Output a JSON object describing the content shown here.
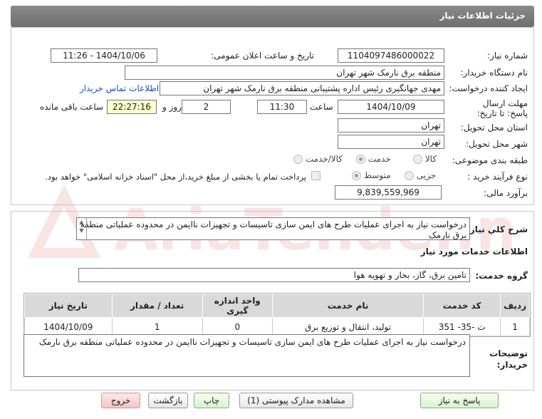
{
  "window": {
    "title": "جزئیات اطلاعات نیاز"
  },
  "form": {
    "need_number_label": "شماره نیاز:",
    "need_number": "1104097486000022",
    "announce_label": "تاریخ و ساعت اعلان عمومی:",
    "announce_value": "1404/10/06 - 11:26",
    "buyer_org_label": "نام دستگاه خریدار:",
    "buyer_org": "منطقه برق نارمک شهر تهران",
    "creator_label": "ایجاد کننده درخواست:",
    "creator": "مهدی جهانگیری رئیس اداره پشتیبانی  منطقه برق نارمک شهر تهران",
    "contact_link": "اطلاعات تماس خریدار",
    "deadline_label": "مهلت ارسال پاسخ: تا تاریخ:",
    "deadline_date": "1404/10/09",
    "time_label": "ساعت",
    "deadline_time": "11:30",
    "days_value": "2",
    "days_label": "روز و",
    "remaining_value": "22:27:16",
    "remaining_label": "ساعت باقی مانده",
    "province_label": "استان محل تحویل:",
    "province": "تهران",
    "city_label": "شهر محل تحویل:",
    "city": "تهران",
    "category_label": "طبقه بندی موضوعی:",
    "category_options": [
      "کالا",
      "خدمت",
      "کالا/خدمت"
    ],
    "process_label": "نوع فرآیند خرید :",
    "process_options": [
      "جزیی",
      "متوسط"
    ],
    "payment_note": "پرداخت تمام یا بخشی از مبلغ خرید،از محل \"اسناد خزانه اسلامی\" خواهد بود.",
    "budget_label": "برآورد مالی:",
    "budget": "9,839,559,969"
  },
  "summary": {
    "label": "شرح کلي نياز:",
    "text": "درخواست نیاز به اجرای عملیات طرح های ایمن سازی تاسیسات و تجهیزات ناایمن در محدوده عملیاتی منطقه برق نارمک"
  },
  "services": {
    "section_title": "اطلاعات خدمات مورد نیاز",
    "group_label": "گروه خدمت:",
    "group_value": "تامین برق، گاز، بخار و تهویه هوا",
    "columns": [
      "ردیف",
      "کد خدمت",
      "نام خدمت",
      "واحد اندازه گیری",
      "تعداد / مقدار",
      "تاریخ نیاز"
    ],
    "rows": [
      [
        "1",
        "ت -35- 351",
        "تولید، انتقال و توزیع برق",
        "0",
        "1",
        "1404/10/09"
      ]
    ]
  },
  "buyer_notes": {
    "label": "توضیحات خریدار:",
    "text": "درخواست نیاز به اجرای عملیات طرح های ایمن سازی تاسیسات و تجهیزات ناایمن در محدوده عملیاتی منطقه برق نارمک"
  },
  "buttons": {
    "reply": "پاسخ به نیاز",
    "attachments": "مشاهده مدارک پیوستی (1)",
    "print": "چاپ",
    "back": "بازگشت",
    "exit": "خروج"
  },
  "watermark": {
    "text": "AriaTender.net"
  },
  "colors": {
    "link": "#1a4fc4",
    "titlebar": "#7b7b7b",
    "highlight": "#ffffcc"
  }
}
